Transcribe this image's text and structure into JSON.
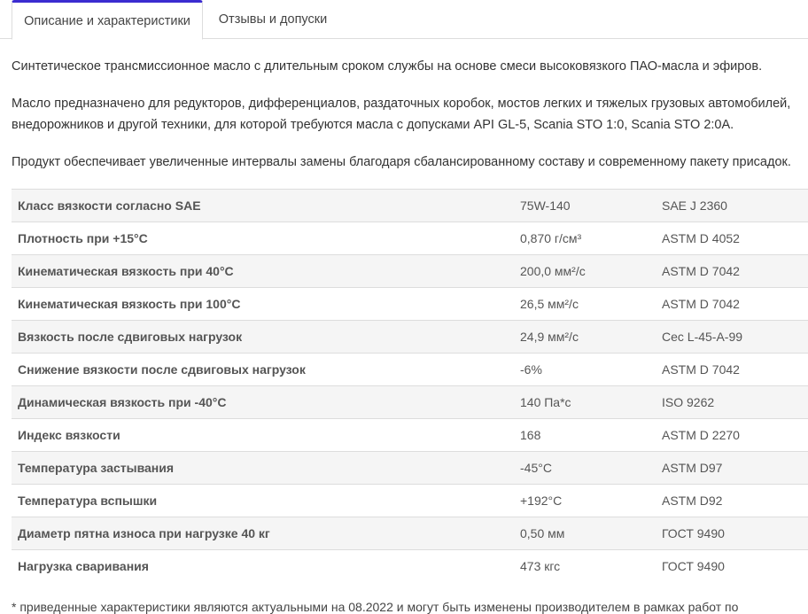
{
  "tabs": [
    {
      "label": "Описание и характеристики",
      "active": true
    },
    {
      "label": "Отзывы и допуски",
      "active": false
    }
  ],
  "description": [
    "Синтетическое трансмиссионное масло с длительным сроком службы на основе смеси высоковязкого ПАО-масла и эфиров.",
    "Масло предназначено для редукторов, дифференциалов, раздаточных коробок, мостов легких и тяжелых грузовых автомобилей, внедорожников и другой техники, для которой требуются масла с допусками API GL-5, Scania STO 1:0, Scania STO 2:0A.",
    "Продукт обеспечивает увеличенные интервалы замены благодаря сбалансированному составу и современному пакету присадок."
  ],
  "specs": [
    {
      "name": "Класс вязкости согласно SAE",
      "value": "75W-140",
      "standard": "SAE J 2360"
    },
    {
      "name": "Плотность при +15°C",
      "value": "0,870 г/см³",
      "standard": "ASTM D 4052"
    },
    {
      "name": "Кинематическая вязкость при 40°C",
      "value": "200,0 мм²/с",
      "standard": "ASTM D 7042"
    },
    {
      "name": "Кинематическая вязкость при 100°C",
      "value": "26,5 мм²/с",
      "standard": "ASTM D 7042"
    },
    {
      "name": "Вязкость после сдвиговых нагрузок",
      "value": "24,9 мм²/с",
      "standard": "Cec L-45-A-99"
    },
    {
      "name": "Снижение вязкости после сдвиговых нагрузок",
      "value": "-6%",
      "standard": "ASTM D 7042"
    },
    {
      "name": "Динамическая вязкость при -40°C",
      "value": "140 Па*с",
      "standard": "ISO 9262"
    },
    {
      "name": "Индекс вязкости",
      "value": "168",
      "standard": "ASTM D 2270"
    },
    {
      "name": "Температура застывания",
      "value": "-45°C",
      "standard": "ASTM D97"
    },
    {
      "name": "Температура вспышки",
      "value": "+192°C",
      "standard": "ASTM D92"
    },
    {
      "name": "Диаметр пятна износа при нагрузке 40 кг",
      "value": "0,50 мм",
      "standard": "ГОСТ 9490"
    },
    {
      "name": "Нагрузка сваривания",
      "value": "473 кгс",
      "standard": "ГОСТ 9490"
    }
  ],
  "footnote": "* приведенные характеристики являются актуальными на 08.2022 и могут быть изменены производителем в рамках работ по",
  "colors": {
    "accent": "#3b2cd0",
    "row_alt": "#f5f5f5",
    "border": "#dddddd"
  }
}
